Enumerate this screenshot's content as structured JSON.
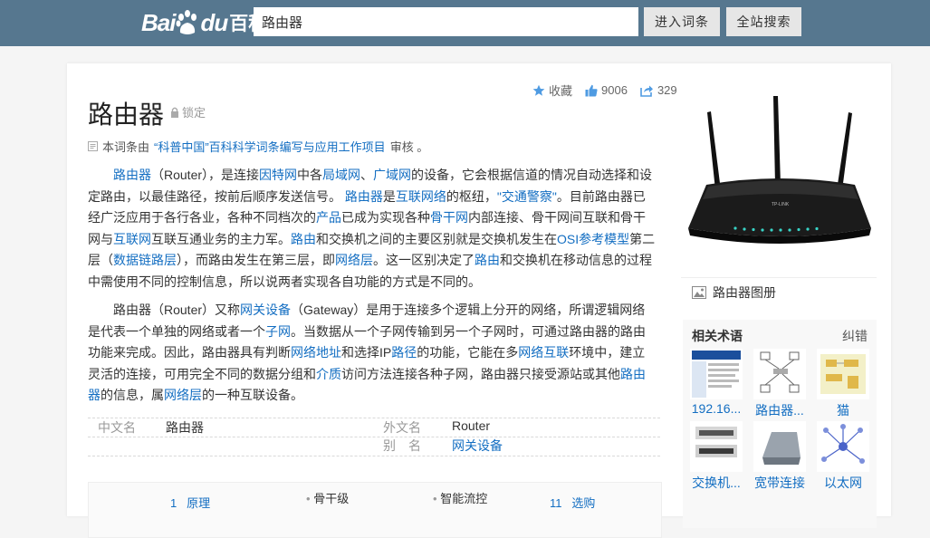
{
  "header": {
    "logo_bai": "Bai",
    "logo_du": "du",
    "logo_baike": "百科",
    "search_value": "路由器",
    "enter_button": "进入词条",
    "site_search_button": "全站搜索"
  },
  "entry": {
    "title": "路由器",
    "lock_label": "锁定",
    "favorite_label": "收藏",
    "like_count": "9006",
    "share_count": "329",
    "review_prefix": "本词条由",
    "review_org": "“科普中国”百科科学词条编写与应用工作项目",
    "review_suffix": "审核 。"
  },
  "paragraphs": {
    "p1": [
      {
        "t": "路由器",
        "link": true
      },
      {
        "t": "（Router），是连接",
        "link": false
      },
      {
        "t": "因特网",
        "link": true
      },
      {
        "t": "中各",
        "link": false
      },
      {
        "t": "局域网",
        "link": true
      },
      {
        "t": "、",
        "link": false
      },
      {
        "t": "广域网",
        "link": true
      },
      {
        "t": "的设备，它会根据信道的情况自动选择和设定路由，以最佳路径，按前后顺序发送信号。 ",
        "link": false
      },
      {
        "t": "路由器",
        "link": true
      },
      {
        "t": "是",
        "link": false
      },
      {
        "t": "互联网络",
        "link": true
      },
      {
        "t": "的枢纽，",
        "link": false
      },
      {
        "t": "\"交通警察\"",
        "link": true
      },
      {
        "t": "。目前路由器已经广泛应用于各行各业，各种不同档次的",
        "link": false
      },
      {
        "t": "产品",
        "link": true
      },
      {
        "t": "已成为实现各种",
        "link": false
      },
      {
        "t": "骨干网",
        "link": true
      },
      {
        "t": "内部连接、骨干网间互联和骨干网与",
        "link": false
      },
      {
        "t": "互联网",
        "link": true
      },
      {
        "t": "互联互通业务的主力军。",
        "link": false
      },
      {
        "t": "路由",
        "link": true
      },
      {
        "t": "和交换机之间的主要区别就是交换机发生在",
        "link": false
      },
      {
        "t": "OSI参考模型",
        "link": true
      },
      {
        "t": "第二层（",
        "link": false
      },
      {
        "t": "数据链路层",
        "link": true
      },
      {
        "t": "），而路由发生在第三层，即",
        "link": false
      },
      {
        "t": "网络层",
        "link": true
      },
      {
        "t": "。这一区别决定了",
        "link": false
      },
      {
        "t": "路由",
        "link": true
      },
      {
        "t": "和交换机在移动信息的过程中需使用不同的控制信息，所以说两者实现各自功能的方式是不同的。",
        "link": false
      }
    ],
    "p2": [
      {
        "t": "路由器（Router）又称",
        "link": false
      },
      {
        "t": "网关设备",
        "link": true
      },
      {
        "t": "（Gateway）是用于连接多个逻辑上分开的网络，所谓逻辑网络是代表一个单独的网络或者一个",
        "link": false
      },
      {
        "t": "子网",
        "link": true
      },
      {
        "t": "。当数据从一个子网传输到另一个子网时，可通过路由器的路由功能来完成。因此，路由器具有判断",
        "link": false
      },
      {
        "t": "网络地址",
        "link": true
      },
      {
        "t": "和选择IP",
        "link": false
      },
      {
        "t": "路径",
        "link": true
      },
      {
        "t": "的功能，它能在多",
        "link": false
      },
      {
        "t": "网络互联",
        "link": true
      },
      {
        "t": "环境中，建立灵活的连接，可用完全不同的数据分组和",
        "link": false
      },
      {
        "t": "介质",
        "link": true
      },
      {
        "t": "访问方法连接各种子网，路由器只接受源站或其他",
        "link": false
      },
      {
        "t": "路由器",
        "link": true
      },
      {
        "t": "的信息，属",
        "link": false
      },
      {
        "t": "网络层",
        "link": true
      },
      {
        "t": "的一种互联设备。",
        "link": false
      }
    ]
  },
  "basic_info": {
    "cn_name_key": "中文名",
    "cn_name_val": "路由器",
    "foreign_key": "外文名",
    "foreign_val": "Router",
    "alias_key": "别　名",
    "alias_val": "网关设备"
  },
  "catalog": {
    "item1_num": "1",
    "item1_label": "原理",
    "item2_label": "骨干级",
    "item3_label": "智能流控",
    "item4_num": "11",
    "item4_label": "选购"
  },
  "side": {
    "album_label": "路由器图册",
    "related_heading": "相关术语",
    "error_link": "纠错",
    "related": [
      "192.16...",
      "路由器...",
      "猫",
      "交换机...",
      "宽带连接",
      "以太网"
    ]
  },
  "colors": {
    "topbar": "#56778f",
    "link": "#136ec2",
    "action_icon": "#4f9be2"
  }
}
